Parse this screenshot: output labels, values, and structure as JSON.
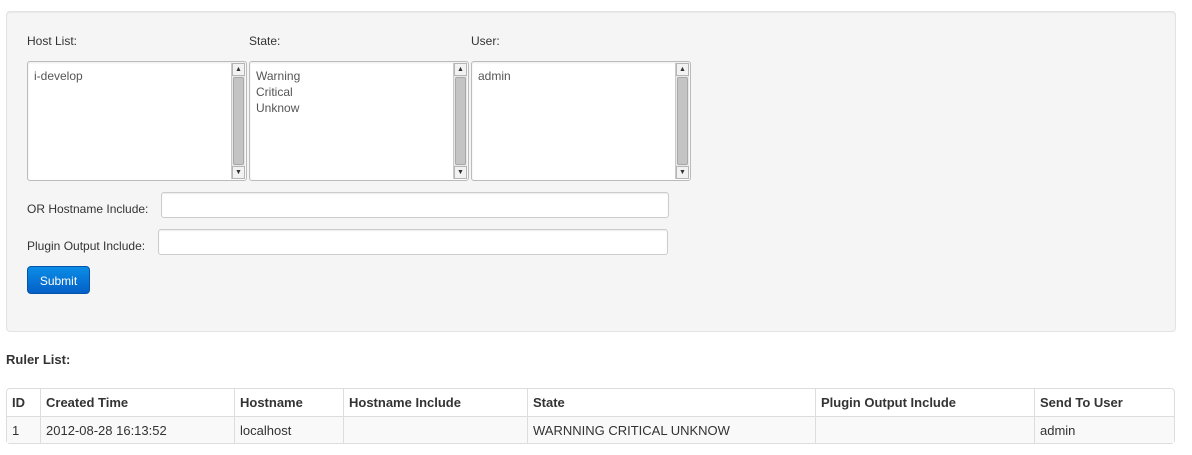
{
  "filter_form": {
    "host_list": {
      "label": "Host List:",
      "options": [
        "i-develop"
      ]
    },
    "state": {
      "label": "State:",
      "options": [
        "Warning",
        "Critical",
        "Unknow"
      ]
    },
    "user": {
      "label": "User:",
      "options": [
        "admin"
      ]
    },
    "hostname_include": {
      "label": "OR Hostname Include:",
      "value": ""
    },
    "plugin_output_include": {
      "label": "Plugin Output Include:",
      "value": ""
    },
    "submit_label": "Submit",
    "submit_color": "#0a7ad9"
  },
  "ruler_list": {
    "title": "Ruler List:",
    "columns": [
      "ID",
      "Created Time",
      "Hostname",
      "Hostname Include",
      "State",
      "Plugin Output Include",
      "Send To User"
    ],
    "rows": [
      [
        "1",
        "2012-08-28 16:13:52",
        "localhost",
        "",
        "WARNNING CRITICAL UNKNOW",
        "",
        "admin"
      ]
    ]
  }
}
